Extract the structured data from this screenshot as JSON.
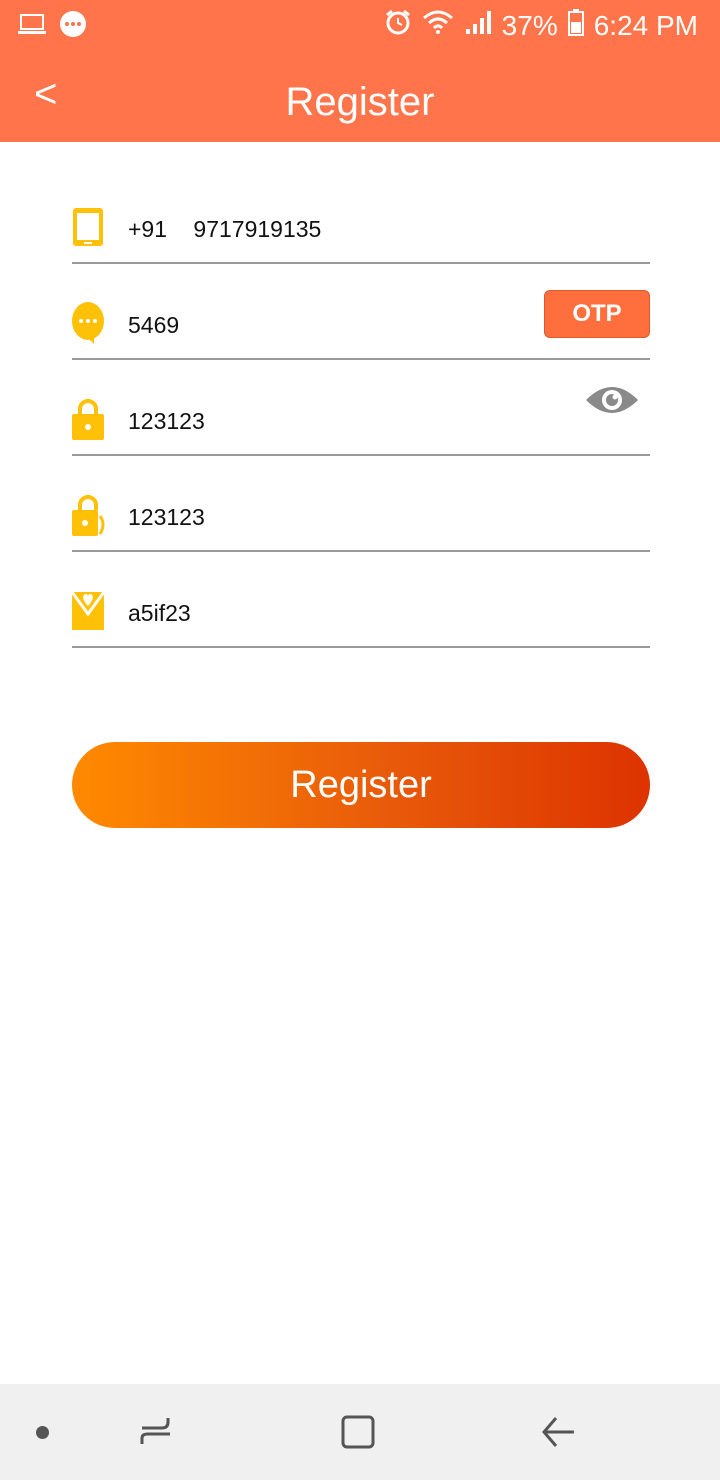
{
  "status_bar": {
    "battery": "37%",
    "time": "6:24 PM",
    "icons": [
      "laptop-icon",
      "chat-bubble-icon",
      "alarm-icon",
      "wifi-icon",
      "signal-icon",
      "battery-icon"
    ]
  },
  "app_bar": {
    "back": "<",
    "title": "Register"
  },
  "form": {
    "phone": {
      "icon": "phone-icon",
      "country_code": "+91",
      "value": "9717919135"
    },
    "otp": {
      "icon": "chat-bubble-icon",
      "value": "5469",
      "button_label": "OTP"
    },
    "password": {
      "icon": "lock-icon",
      "value": "123123"
    },
    "confirm_password": {
      "icon": "lock-confirm-icon",
      "value": "123123"
    },
    "referral": {
      "icon": "referral-heart-icon",
      "value": "a5if23"
    }
  },
  "register_button": {
    "label": "Register"
  },
  "colors": {
    "primary": "#ff744a",
    "icon_yellow": "#ffc107",
    "otp_button": "#ff6f3e",
    "gradient_start": "#ff8a00",
    "gradient_end": "#dd3300"
  },
  "nav_bar": {
    "icons": [
      "dot-icon",
      "recent-apps-icon",
      "home-icon",
      "back-icon"
    ]
  }
}
